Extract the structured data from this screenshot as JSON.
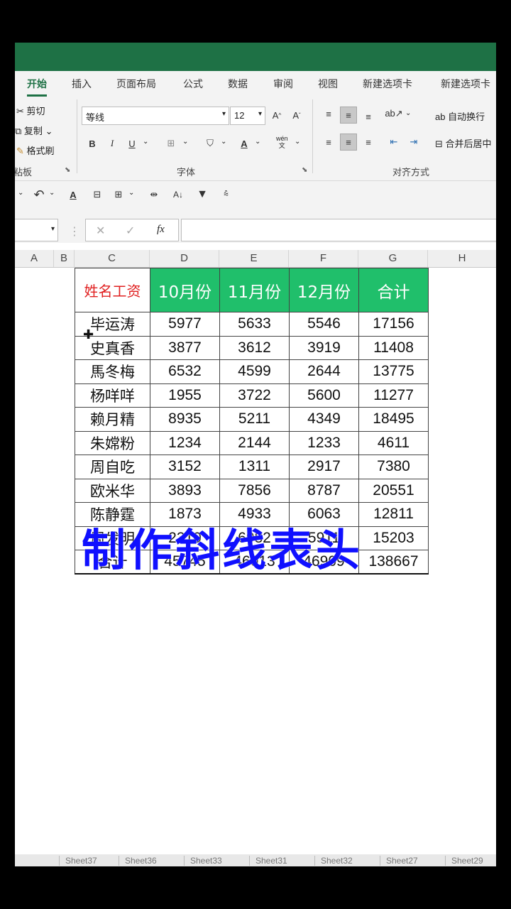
{
  "ribbon_tabs": [
    "开始",
    "插入",
    "页面布局",
    "公式",
    "数据",
    "审阅",
    "视图",
    "新建选项卡",
    "新建选项卡"
  ],
  "clipboard": {
    "cut": "剪切",
    "copy": "复制",
    "format_painter": "格式刷",
    "group": "粘板"
  },
  "font": {
    "name": "等线",
    "size": "12",
    "group": "字体",
    "bold": "B",
    "italic": "I",
    "underline": "U",
    "wen": "wén\n文"
  },
  "alignment": {
    "wrap": "自动换行",
    "merge": "合并后居中",
    "group": "对齐方式"
  },
  "formula_bar": {
    "cancel": "✕",
    "enter": "✓",
    "fx": "fx",
    "value": ""
  },
  "columns": [
    "A",
    "B",
    "C",
    "D",
    "E",
    "F",
    "G",
    "H"
  ],
  "table": {
    "header": [
      "姓名工资",
      "10月份",
      "11月份",
      "12月份",
      "合计"
    ],
    "rows": [
      [
        "毕运涛",
        "5977",
        "5633",
        "5546",
        "17156"
      ],
      [
        "史真香",
        "3877",
        "3612",
        "3919",
        "11408"
      ],
      [
        "馬冬梅",
        "6532",
        "4599",
        "2644",
        "13775"
      ],
      [
        "杨咩咩",
        "1955",
        "3722",
        "5600",
        "11277"
      ],
      [
        "赖月精",
        "8935",
        "5211",
        "4349",
        "18495"
      ],
      [
        "朱嫦粉",
        "1234",
        "2144",
        "1233",
        "4611"
      ],
      [
        "周自吃",
        "3152",
        "1311",
        "2917",
        "7380"
      ],
      [
        "欧米华",
        "3893",
        "7856",
        "8787",
        "20551"
      ],
      [
        "陈静霆",
        "1873",
        "4933",
        "6063",
        "12811"
      ],
      [
        "周发明",
        "2310",
        "6982",
        "5911",
        "15203"
      ]
    ],
    "total": [
      "合计",
      "45745",
      "46013",
      "46909",
      "138667"
    ]
  },
  "overlay_text": "制作斜线表头",
  "sheet_tabs": [
    "Sheet37",
    "Sheet36",
    "Sheet33",
    "Sheet31",
    "Sheet32",
    "Sheet27",
    "Sheet29"
  ],
  "colors": {
    "excel_green": "#1e7145",
    "header_fill": "#20bf6b",
    "header_red": "#e02020",
    "overlay_blue": "#1010ff"
  }
}
